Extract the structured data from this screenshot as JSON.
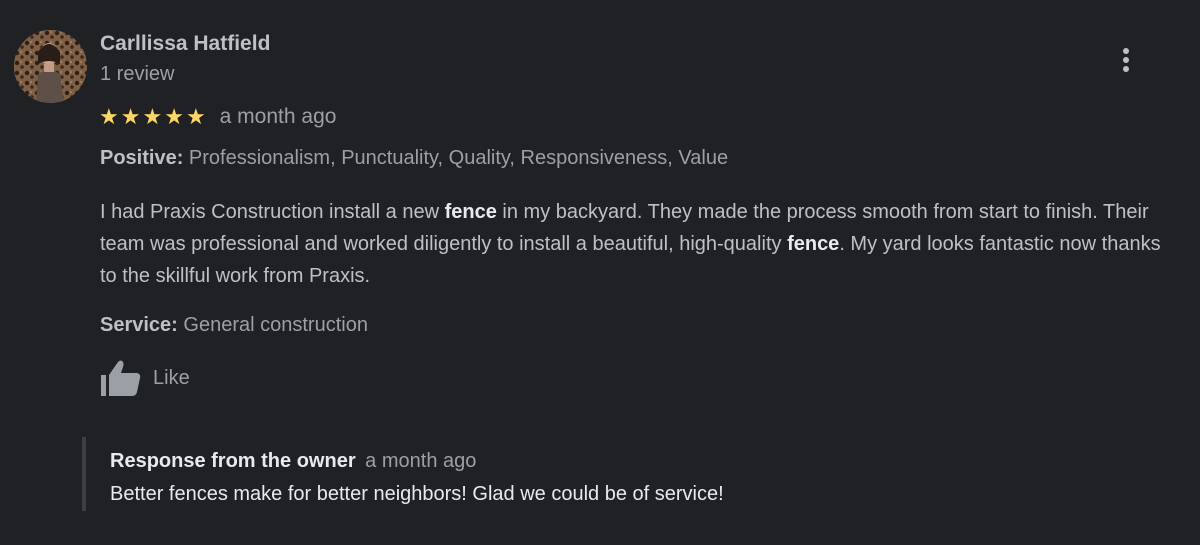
{
  "reviewer": {
    "name": "Carllissa Hatfield",
    "review_count": "1 review"
  },
  "rating": {
    "stars": 5,
    "max": 5,
    "star_color": "#fdd663",
    "date": "a month ago"
  },
  "positive": {
    "label": "Positive:",
    "value": "Professionalism, Punctuality, Quality, Responsiveness, Value"
  },
  "review": {
    "part1": "I had Praxis Construction install a new ",
    "highlight1": "fence",
    "part2": " in my backyard. They made the process smooth from start to finish. Their team was professional and worked  diligently to install a beautiful, high-quality ",
    "highlight2": "fence",
    "part3": ". My yard looks fantastic now thanks to the skillful work from Praxis."
  },
  "service": {
    "label": "Service:",
    "value": "General construction"
  },
  "actions": {
    "like_label": "Like",
    "like_icon": "thumbs-up-icon",
    "menu_icon": "more-vert-icon"
  },
  "owner_response": {
    "title": "Response from the owner",
    "date": "a month ago",
    "text": "Better fences make for better neighbors! Glad we could be of service!"
  },
  "colors": {
    "background": "#202124",
    "text_primary": "#e8eaed",
    "text_secondary": "#9aa0a6"
  }
}
